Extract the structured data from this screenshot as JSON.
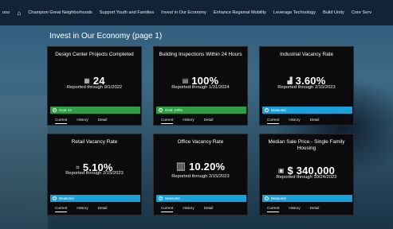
{
  "nav": {
    "items": [
      "ooo",
      "Champion Great Neighborhoods",
      "Support Youth and Families",
      "Invest in Our Economy",
      "Enhance Regional Mobility",
      "Leverage Technology",
      "Build Unity",
      "Core Serv"
    ]
  },
  "page": {
    "title": "Invest in Our Economy (page 1)"
  },
  "cards": [
    {
      "title": "Design Center Projects Completed",
      "icon": "building-icon",
      "value": "24",
      "reported": "Reported through 9/1/2022",
      "status": "Goal: 24",
      "status_color": "#2e9d43",
      "tabs": [
        "Current",
        "History",
        "Detail"
      ]
    },
    {
      "title": "Building Inspections Within 24 Hours",
      "icon": "inspection-icon",
      "value": "100%",
      "reported": "Reported through 1/31/2024",
      "status": "Goal: 100%",
      "status_color": "#2e9d43",
      "tabs": [
        "Current",
        "History",
        "Detail"
      ]
    },
    {
      "title": "Industrial Vacancy Rate",
      "icon": "chart-icon",
      "value": "3.60%",
      "reported": "Reported through 2/15/2023",
      "status": "Measured",
      "status_color": "#1aa0d8",
      "tabs": [
        "Current",
        "History",
        "Detail"
      ]
    },
    {
      "title": "Retail Vacancy Rate",
      "icon": "retail-icon",
      "value": "5.10%",
      "reported": "Reported through 2/15/2023",
      "status": "Measured",
      "status_color": "#1aa0d8",
      "tabs": [
        "Current",
        "History",
        "Detail"
      ]
    },
    {
      "title": "Office Vacancy Rate",
      "icon": "office-icon",
      "value": "10.20%",
      "reported": "Reported through 2/15/2023",
      "status": "Measured",
      "status_color": "#1aa0d8",
      "tabs": [
        "Current",
        "History",
        "Detail"
      ]
    },
    {
      "title": "Median Sale Price - Single Family Housing",
      "icon": "house-icon",
      "value": "$ 340,000",
      "reported": "Reported through 10/24/2023",
      "status": "Measured",
      "status_color": "#1aa0d8",
      "tabs": [
        "Current",
        "History",
        "Detail"
      ]
    }
  ]
}
